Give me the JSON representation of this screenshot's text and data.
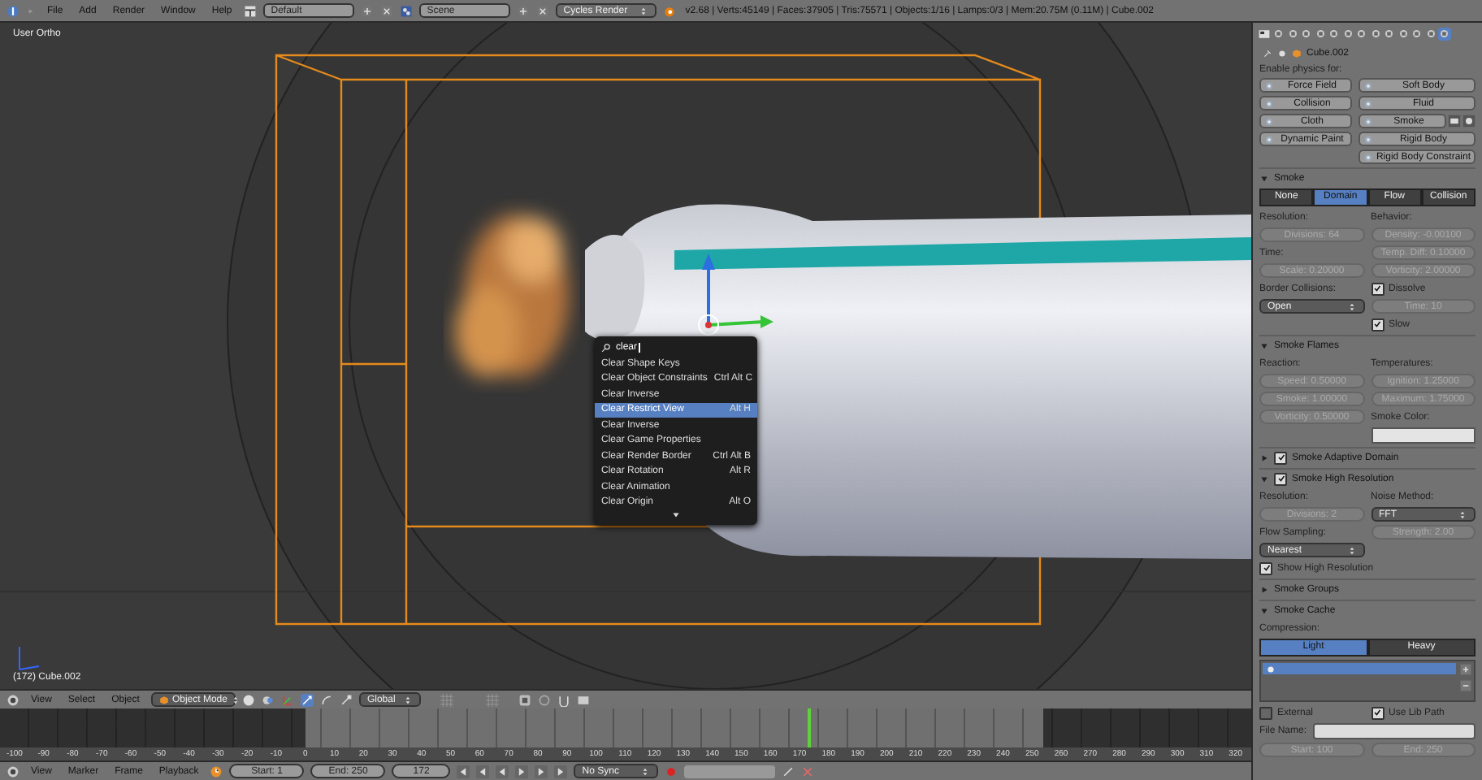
{
  "top_bar": {
    "menus": [
      "File",
      "Add",
      "Render",
      "Window",
      "Help"
    ],
    "layout": "Default",
    "scene": "Scene",
    "engine": "Cycles Render",
    "stats": "v2.68 | Verts:45149 | Faces:37905 | Tris:75571 | Objects:1/16 | Lamps:0/3 | Mem:20.75M (0.11M) | Cube.002"
  },
  "viewport": {
    "view_label": "User Ortho",
    "object_label": "(172) Cube.002",
    "search_menu": {
      "query": "clear",
      "items": [
        {
          "label": "Clear Shape Keys",
          "selected": false
        },
        {
          "label": "Clear Object Constraints",
          "shortcut": "Ctrl Alt C",
          "selected": false
        },
        {
          "label": "Clear Inverse",
          "selected": false
        },
        {
          "label": "Clear Restrict View",
          "shortcut": "Alt H",
          "selected": true
        },
        {
          "label": "Clear Inverse",
          "selected": false
        },
        {
          "label": "Clear Game Properties",
          "selected": false
        },
        {
          "label": "Clear Render Border",
          "shortcut": "Ctrl Alt B",
          "selected": false
        },
        {
          "label": "Clear Rotation",
          "shortcut": "Alt R",
          "selected": false
        },
        {
          "label": "Clear Animation",
          "selected": false
        },
        {
          "label": "Clear Origin",
          "shortcut": "Alt O",
          "selected": false
        }
      ]
    }
  },
  "viewport_header": {
    "menus": [
      "View",
      "Select",
      "Object"
    ],
    "mode": "Object Mode",
    "orientation": "Global"
  },
  "timeline": {
    "playhead": {
      "level": 0.645
    },
    "ruler": [
      "-100",
      "-90",
      "-80",
      "-70",
      "-60",
      "-50",
      "-40",
      "-30",
      "-20",
      "-10",
      "0",
      "10",
      "20",
      "30",
      "40",
      "50",
      "60",
      "70",
      "80",
      "90",
      "100",
      "110",
      "120",
      "130",
      "140",
      "150",
      "160",
      "170",
      "180",
      "190",
      "200",
      "210",
      "220",
      "230",
      "240",
      "250",
      "260",
      "270",
      "280",
      "290",
      "300",
      "310",
      "320"
    ]
  },
  "timeline_header": {
    "menus": [
      "View",
      "Marker",
      "Frame",
      "Playback"
    ],
    "start": "Start: 1",
    "end": "End: 250",
    "frame": "172",
    "sync": "No Sync"
  },
  "properties": {
    "context_tabs": [
      {
        "selected": false
      },
      {
        "selected": false
      },
      {
        "selected": false
      },
      {
        "selected": false
      },
      {
        "selected": false
      },
      {
        "selected": false
      },
      {
        "selected": false
      },
      {
        "selected": false
      },
      {
        "selected": false
      },
      {
        "selected": false
      },
      {
        "selected": false
      },
      {
        "selected": false
      },
      {
        "selected": true
      }
    ],
    "object": "Cube.002",
    "enable_label": "Enable physics for:",
    "physics_buttons": [
      {
        "label": "Force Field",
        "kind": "plain"
      },
      {
        "label": "Soft Body",
        "kind": "plain"
      },
      {
        "label": "Collision",
        "kind": "plain"
      },
      {
        "label": "Fluid",
        "kind": "plain"
      },
      {
        "label": "Cloth",
        "kind": "plain"
      },
      {
        "label": "Smoke",
        "kind": "toggles"
      },
      {
        "label": "Dynamic Paint",
        "kind": "plain"
      },
      {
        "label": "Rigid Body",
        "kind": "plain"
      },
      {
        "label": "Rigid Body Constraint",
        "kind": "plain"
      }
    ],
    "panels": [
      {
        "title": "Smoke",
        "expanded": true,
        "rows": [
          [
            {
              "kind": "tabs",
              "tabs": [
                {
                  "label": "None",
                  "selected": false
                },
                {
                  "label": "Domain",
                  "selected": true
                },
                {
                  "label": "Flow",
                  "selected": false
                },
                {
                  "label": "Collision",
                  "selected": false
                }
              ]
            }
          ],
          [
            {
              "kind": "label",
              "text": "Resolution:"
            },
            {
              "kind": "label",
              "text": "Behavior:"
            }
          ],
          [
            {
              "kind": "field",
              "text": "Divisions: 64"
            },
            {
              "kind": "field",
              "text": "Density: -0.00100"
            }
          ],
          [
            {
              "kind": "label",
              "text": "Time:"
            },
            {
              "kind": "field",
              "text": "Temp. Diff: 0.10000"
            }
          ],
          [
            {
              "kind": "field",
              "text": "Scale: 0.20000"
            },
            {
              "kind": "field",
              "text": "Vorticity: 2.00000"
            }
          ],
          [
            {
              "kind": "label",
              "text": "Border Collisions:"
            },
            {
              "kind": "check",
              "text": "Dissolve",
              "checked": true
            }
          ],
          [
            {
              "kind": "dropdown",
              "text": "Open"
            },
            {
              "kind": "field",
              "text": "Time: 10"
            }
          ],
          [
            {
              "kind": "blank"
            },
            {
              "kind": "check",
              "text": "Slow",
              "checked": true
            }
          ]
        ]
      },
      {
        "title": "Smoke Flames",
        "expanded": true,
        "rows": [
          [
            {
              "kind": "label",
              "text": "Reaction:"
            },
            {
              "kind": "label",
              "text": "Temperatures:"
            }
          ],
          [
            {
              "kind": "field",
              "text": "Speed: 0.50000"
            },
            {
              "kind": "field",
              "text": "Ignition: 1.25000"
            }
          ],
          [
            {
              "kind": "field",
              "text": "Smoke: 1.00000"
            },
            {
              "kind": "field",
              "text": "Maximum: 1.75000"
            }
          ],
          [
            {
              "kind": "field",
              "text": "Vorticity: 0.50000"
            },
            {
              "kind": "label",
              "text": "Smoke Color:"
            }
          ],
          [
            {
              "kind": "blank"
            },
            {
              "kind": "swatch"
            }
          ]
        ]
      },
      {
        "title": "Smoke Adaptive Domain",
        "expanded": false,
        "checked": true
      },
      {
        "title": "Smoke High Resolution",
        "expanded": true,
        "checked": true,
        "rows": [
          [
            {
              "kind": "label",
              "text": "Resolution:"
            },
            {
              "kind": "label",
              "text": "Noise Method:"
            }
          ],
          [
            {
              "kind": "field",
              "text": "Divisions: 2"
            },
            {
              "kind": "dropdown",
              "text": "FFT"
            }
          ],
          [
            {
              "kind": "label",
              "text": "Flow Sampling:"
            },
            {
              "kind": "field",
              "text": "Strength: 2.00"
            }
          ],
          [
            {
              "kind": "dropdown",
              "text": "Nearest"
            },
            {
              "kind": "blank"
            }
          ],
          [
            {
              "kind": "check",
              "text": "Show High Resolution",
              "checked": true
            }
          ]
        ]
      },
      {
        "title": "Smoke Groups",
        "expanded": false
      },
      {
        "title": "Smoke Cache",
        "expanded": true,
        "rows": [
          [
            {
              "kind": "label",
              "text": "Compression:"
            }
          ],
          [
            {
              "kind": "tabs",
              "tabs": [
                {
                  "label": "Light",
                  "selected": true
                },
                {
                  "label": "Heavy",
                  "selected": false
                }
              ]
            }
          ],
          [
            {
              "kind": "list"
            }
          ],
          [
            {
              "kind": "check",
              "text": "External",
              "checked": false
            },
            {
              "kind": "check",
              "text": "Use Lib Path",
              "checked": true
            }
          ],
          [
            {
              "kind": "text-field",
              "text": "File Name:"
            }
          ],
          [
            {
              "kind": "field",
              "text": "Start: 100"
            },
            {
              "kind": "field",
              "text": "End: 250"
            }
          ]
        ]
      }
    ]
  }
}
